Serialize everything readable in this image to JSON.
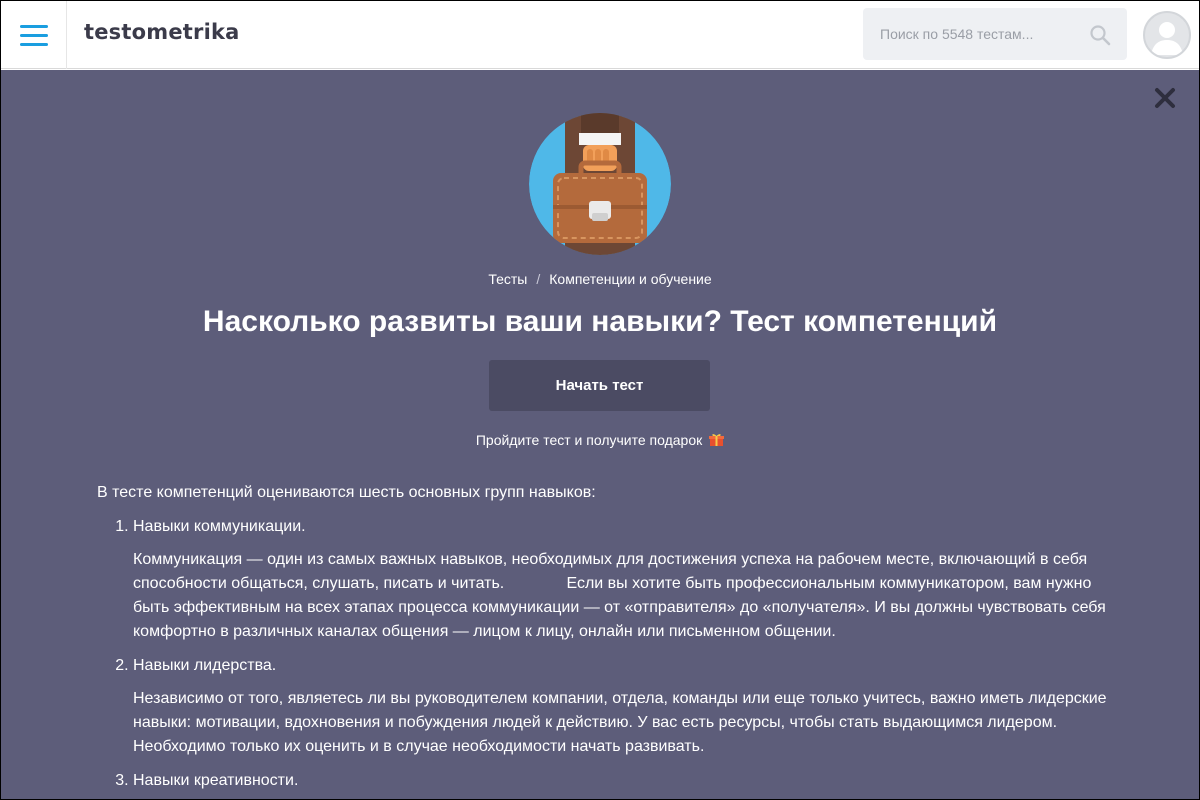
{
  "header": {
    "logo": "testometrika",
    "search_placeholder": "Поиск по 5548 тестам..."
  },
  "breadcrumbs": {
    "items": [
      "Тесты",
      "Компетенции и обучение"
    ],
    "separator": "/"
  },
  "main": {
    "title": "Насколько развиты ваши навыки? Тест компетенций",
    "start_button": "Начать тест",
    "gift_text": "Пройдите тест и получите подарок",
    "intro": "В тесте компетенций оцениваются шесть основных групп навыков:",
    "skills": [
      {
        "name": "Навыки коммуникации.",
        "description": "Коммуникация — один из самых важных навыков, необходимых для достижения успеха на рабочем месте, включающий в себя способности общаться, слушать, писать и читать.              Если вы хотите быть профессиональным коммуникатором, вам нужно быть эффективным на всех этапах процесса коммуникации — от «отправителя» до «получателя». И вы должны чувствовать себя комфортно в различных каналах общения — лицом к лицу, онлайн или письменном общении."
      },
      {
        "name": "Навыки лидерства.",
        "description": "Независимо от того, являетесь ли вы руководителем компании, отдела, команды или еще только учитесь, важно иметь лидерские навыки: мотивации, вдохновения и побуждения людей к действию. У вас есть ресурсы, чтобы стать выдающимся лидером. Необходимо только их оценить и в случае необходимости начать развивать."
      },
      {
        "name": "Навыки креативности.",
        "description": ""
      }
    ]
  },
  "colors": {
    "overlay": "#5d5d7a",
    "accent": "#1a9ee0",
    "button": "#4b4b63"
  },
  "icons": [
    "menu-icon",
    "search-icon",
    "avatar-icon",
    "close-icon",
    "gift-icon",
    "briefcase-illustration"
  ]
}
